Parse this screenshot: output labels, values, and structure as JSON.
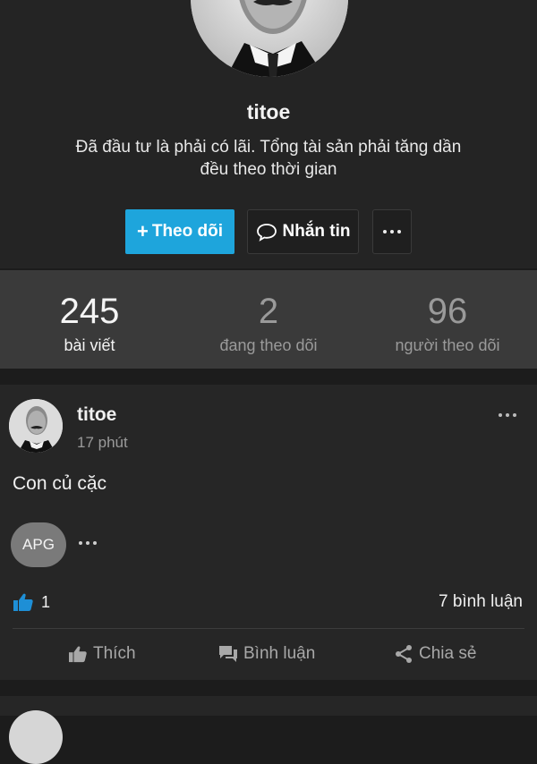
{
  "profile": {
    "username": "titoe",
    "bio_line1": "Đã đầu tư là phải có lãi. Tổng tài sản phải tăng dần",
    "bio_line2": "đều theo thời gian",
    "follow_label": "Theo dõi",
    "message_label": "Nhắn tin"
  },
  "stats": [
    {
      "value": "245",
      "label": "bài viết"
    },
    {
      "value": "2",
      "label": "đang theo dõi"
    },
    {
      "value": "96",
      "label": "người theo dõi"
    }
  ],
  "post": {
    "author": "titoe",
    "time": "17 phút",
    "text": "Con củ cặc",
    "tag": "APG",
    "like_count": "1",
    "comment_count": "7 bình luận",
    "actions": {
      "like": "Thích",
      "comment": "Bình luận",
      "share": "Chia sẻ"
    }
  },
  "colors": {
    "accent": "#1ea5dc",
    "like_icon": "#1e8fd6",
    "background": "#1c1c1c",
    "stats_bar": "#3a3a3a"
  },
  "icons": [
    "plus-icon",
    "chat-bubble-icon",
    "more-dots-icon",
    "thumbs-up-icon",
    "comment-icon",
    "share-icon"
  ]
}
